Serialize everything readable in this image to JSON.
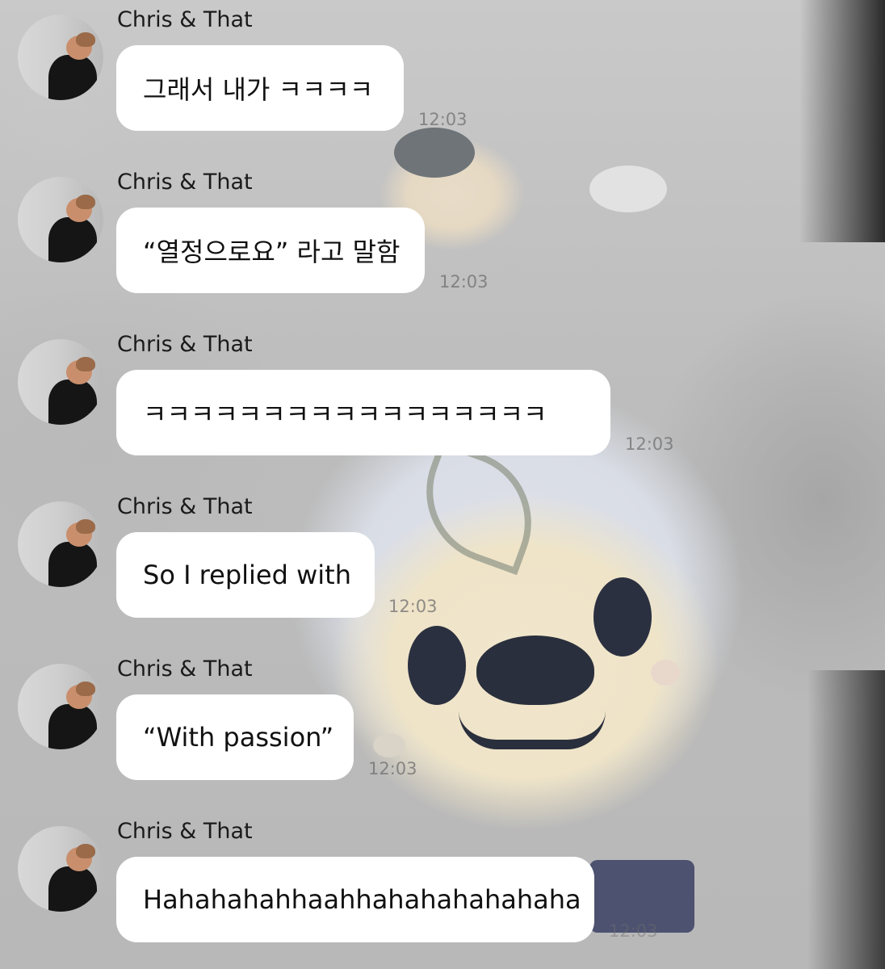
{
  "chat": {
    "messages": [
      {
        "sender": "Chris & That",
        "text": "그래서 내가 ㅋㅋㅋㅋ",
        "time": "12:03",
        "avatar": "profile-photo"
      },
      {
        "sender": "Chris & That",
        "text": "“열정으로요” 라고 말함",
        "time": "12:03",
        "avatar": "profile-photo"
      },
      {
        "sender": "Chris & That",
        "text": "ㅋㅋㅋㅋㅋㅋㅋㅋㅋㅋㅋㅋㅋㅋㅋㅋㅋ",
        "time": "12:03",
        "avatar": "profile-photo"
      },
      {
        "sender": "Chris & That",
        "text": "So I replied with",
        "time": "12:03",
        "avatar": "profile-photo"
      },
      {
        "sender": "Chris & That",
        "text": "“With passion”",
        "time": "12:03",
        "avatar": "profile-photo"
      },
      {
        "sender": "Chris & That",
        "text": "Hahahahahhaahhahahahahahaha",
        "time": "12:03",
        "avatar": "profile-photo"
      }
    ]
  },
  "colors": {
    "bubble": "#ffffff",
    "text": "#111111",
    "timestamp": "#6e6e6e"
  }
}
